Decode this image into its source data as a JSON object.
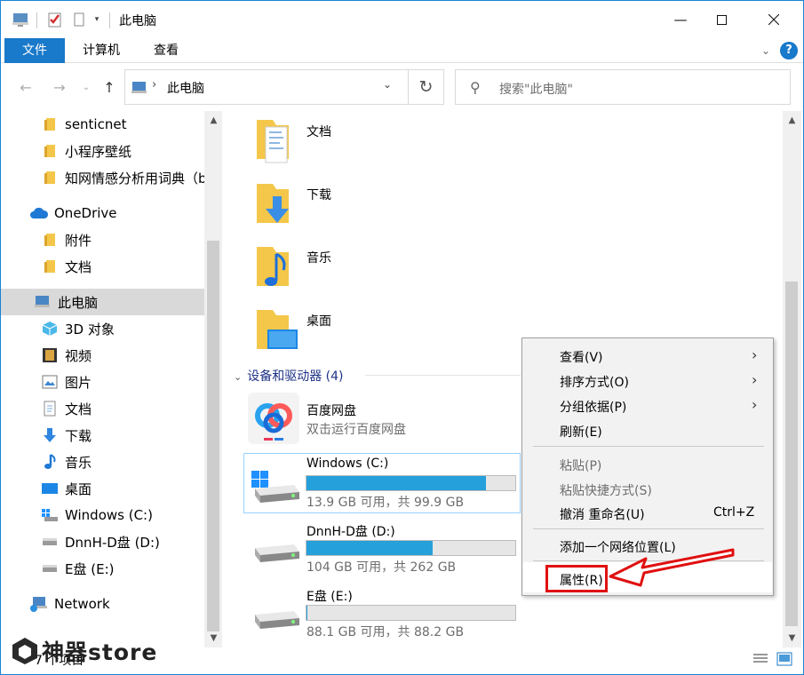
{
  "window": {
    "title": "此电脑"
  },
  "ribbon": {
    "tabs": [
      "文件",
      "计算机",
      "查看"
    ]
  },
  "address": {
    "path": "此电脑",
    "search_placeholder": "搜索\"此电脑\""
  },
  "sidebar": {
    "items": [
      {
        "label": "senticnet",
        "icon": "folder-icon"
      },
      {
        "label": "小程序壁纸",
        "icon": "folder-icon"
      },
      {
        "label": "知网情感分析用词典（b",
        "icon": "folder-icon"
      },
      {
        "label": "OneDrive",
        "icon": "cloud-icon"
      },
      {
        "label": "附件",
        "icon": "folder-icon"
      },
      {
        "label": "文档",
        "icon": "folder-icon"
      },
      {
        "label": "此电脑",
        "icon": "computer-icon"
      },
      {
        "label": "3D 对象",
        "icon": "cube-icon"
      },
      {
        "label": "视频",
        "icon": "film-icon"
      },
      {
        "label": "图片",
        "icon": "picture-icon"
      },
      {
        "label": "文档",
        "icon": "document-icon"
      },
      {
        "label": "下载",
        "icon": "download-icon"
      },
      {
        "label": "音乐",
        "icon": "music-icon"
      },
      {
        "label": "桌面",
        "icon": "desktop-icon"
      },
      {
        "label": "Windows (C:)",
        "icon": "windows-drive-icon"
      },
      {
        "label": "DnnH-D盘 (D:)",
        "icon": "drive-icon"
      },
      {
        "label": "E盘 (E:)",
        "icon": "drive-icon"
      },
      {
        "label": "Network",
        "icon": "network-icon"
      }
    ]
  },
  "main": {
    "folders": [
      "文档",
      "下载",
      "音乐",
      "桌面"
    ],
    "section_header": "设备和驱动器 (4)",
    "drives": [
      {
        "name": "百度网盘",
        "subtitle": "双击运行百度网盘"
      },
      {
        "name": "Windows (C:)",
        "usage": "13.9 GB 可用，共 99.9 GB",
        "used_fraction": 0.861
      },
      {
        "name": "DnnH-D盘 (D:)",
        "usage": "104 GB 可用，共 262 GB",
        "used_fraction": 0.603
      },
      {
        "name": "E盘 (E:)",
        "usage": "88.1 GB 可用，共 88.2 GB",
        "used_fraction": 0.001
      }
    ]
  },
  "context_menu": {
    "items": [
      {
        "label": "查看(V)",
        "submenu": true
      },
      {
        "label": "排序方式(O)",
        "submenu": true
      },
      {
        "label": "分组依据(P)",
        "submenu": true
      },
      {
        "label": "刷新(E)"
      },
      {
        "label": "粘贴(P)",
        "disabled": true
      },
      {
        "label": "粘贴快捷方式(S)",
        "disabled": true
      },
      {
        "label": "撤消 重命名(U)",
        "shortcut": "Ctrl+Z"
      },
      {
        "label": "添加一个网络位置(L)"
      },
      {
        "label": "属性(R)",
        "highlighted": true
      }
    ]
  },
  "status_bar": {
    "item_count": "7 个项目"
  },
  "watermark": {
    "text": "神器store"
  },
  "colors": {
    "accent": "#1979ca",
    "drive_fill": "#26a0da",
    "highlight_box": "#e01010",
    "section_header": "#1e3287"
  }
}
